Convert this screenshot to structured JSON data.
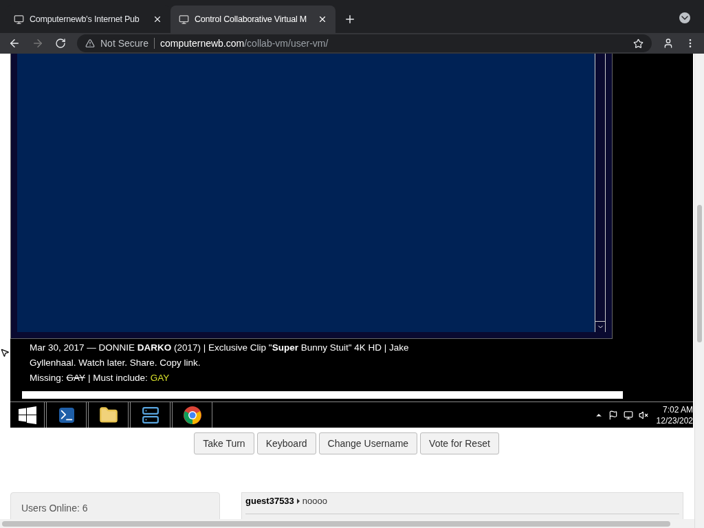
{
  "browser": {
    "tabs": [
      {
        "title": "Computernewb's Internet Pub",
        "selected": false
      },
      {
        "title": "Control Collaborative Virtual M",
        "selected": true
      }
    ],
    "security": "Not Secure",
    "url_host": "computernewb.com",
    "url_path": "/collab-vm/user-vm/"
  },
  "vm_screen": {
    "caption_lines": [
      "Mar 30, 2017 — DONNIE **DARKO** (2017) | Exclusive Clip \"**Super** Bunny Stuit\" 4K HD | Jake",
      "Gyllenhaal. Watch later. Share. Copy link."
    ],
    "missing_label": "Missing:",
    "missing_word": "GAY",
    "include_label": "| Must include:",
    "include_word": "GAY",
    "clock_time": "7:02 AM",
    "clock_date": "12/23/202"
  },
  "buttons": [
    "Take Turn",
    "Keyboard",
    "Change Username",
    "Vote for Reset"
  ],
  "users_online": "Users Online: 6",
  "chat": [
    {
      "user": "guest37533",
      "message": "noooo"
    }
  ]
}
